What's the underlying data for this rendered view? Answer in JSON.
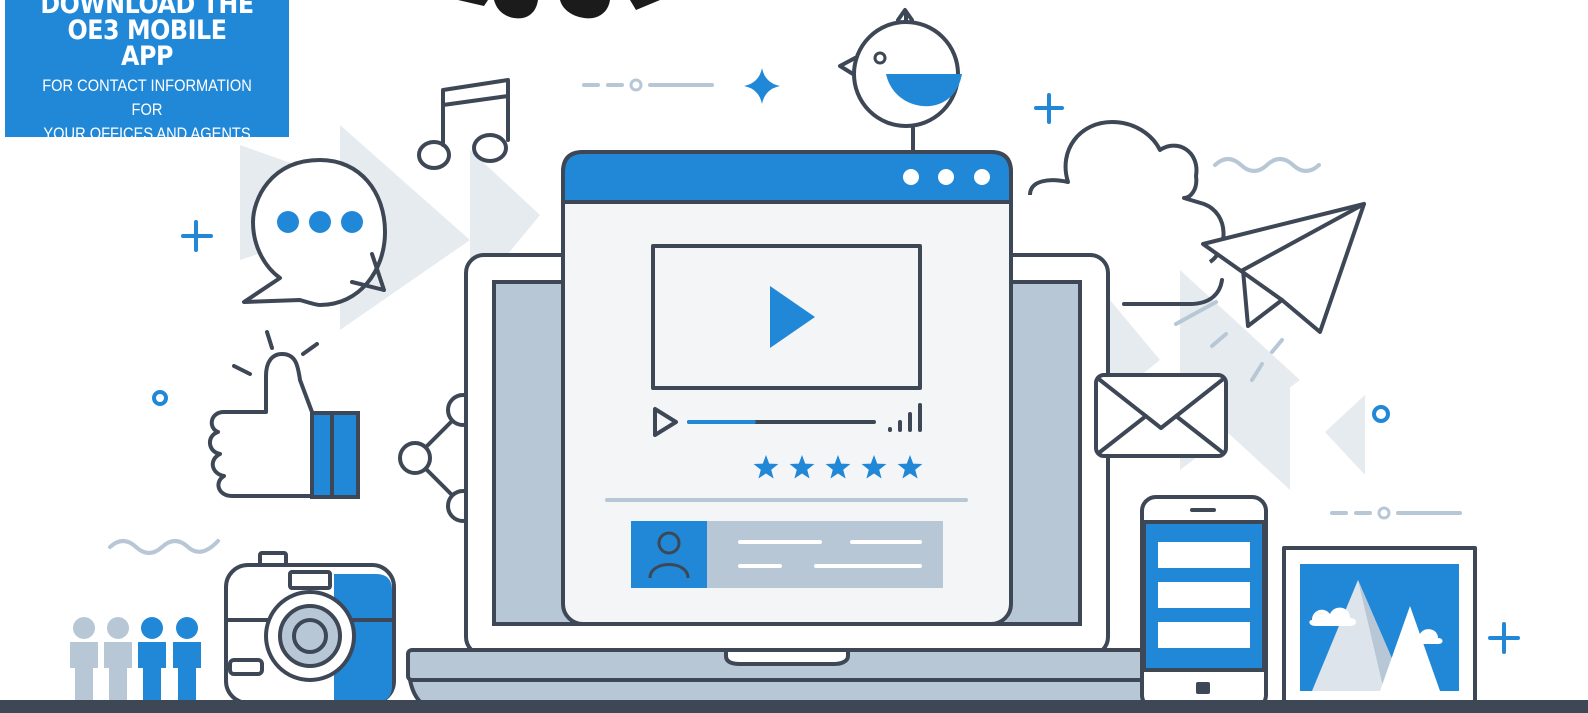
{
  "promo": {
    "title_line1": "DOWNLOAD THE",
    "title_line2": "OE3 MOBILE",
    "title_line3": "APP",
    "subtitle_line1": "FOR CONTACT INFORMATION FOR",
    "subtitle_line2": "YOUR OFFICES AND AGENTS"
  },
  "media_player": {
    "rating_stars": 5,
    "progress_fraction": 0.35
  },
  "colors": {
    "accent": "#2188d8",
    "outline": "#3d4756",
    "muted": "#b8c7d6",
    "panel": "#f4f5f7"
  },
  "icons": [
    "play-icon",
    "share-icon",
    "mail-icon",
    "paper-plane-icon",
    "cloud-icon",
    "bird-icon",
    "music-note-icon",
    "chat-bubble-icon",
    "thumbs-up-icon",
    "camera-icon",
    "smartphone-icon",
    "picture-frame-icon",
    "people-icon",
    "star-icon"
  ]
}
